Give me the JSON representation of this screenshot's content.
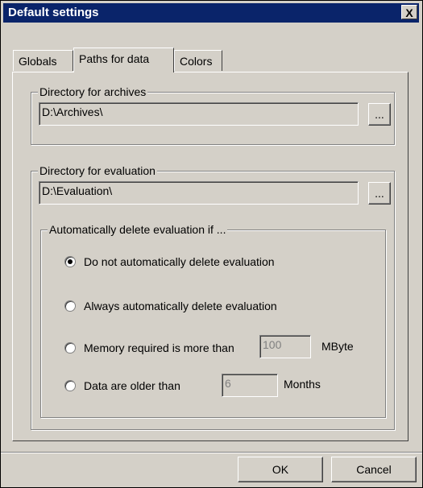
{
  "window": {
    "title": "Default settings",
    "close_label": "X"
  },
  "tabs": [
    {
      "label": "Globals"
    },
    {
      "label": "Paths for data"
    },
    {
      "label": "Colors"
    }
  ],
  "active_tab": "Paths for data",
  "archives": {
    "group_label": "Directory for archives",
    "path_value": "D:\\Archives\\",
    "browse_label": "..."
  },
  "evaluation": {
    "group_label": "Directory for evaluation",
    "path_value": "D:\\Evaluation\\",
    "browse_label": "..."
  },
  "auto_delete": {
    "group_label": "Automatically delete evaluation if ...",
    "options": [
      {
        "label": "Do not automatically delete evaluation",
        "selected": true
      },
      {
        "label": "Always automatically delete evaluation",
        "selected": false
      },
      {
        "label": "Memory required is more than",
        "selected": false
      },
      {
        "label": "Data are older than",
        "selected": false
      }
    ],
    "memory_value": "100",
    "memory_unit": "MByte",
    "age_value": "6",
    "age_unit": "Months"
  },
  "footer": {
    "ok_label": "OK",
    "cancel_label": "Cancel"
  }
}
